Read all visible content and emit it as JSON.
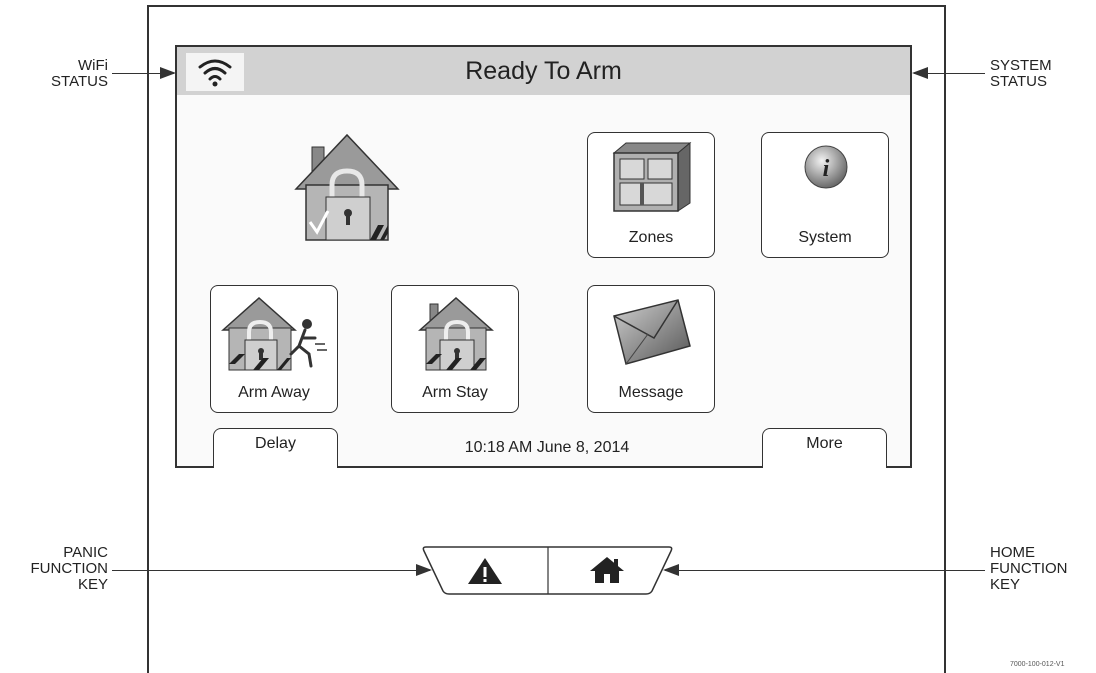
{
  "screen": {
    "system_status": "Ready To Arm",
    "datetime": "10:18 AM June 8, 2014"
  },
  "tiles": [
    {
      "label": "Zones"
    },
    {
      "label": "System"
    },
    {
      "label": "Arm Away"
    },
    {
      "label": "Arm Stay"
    },
    {
      "label": "Message"
    }
  ],
  "tabs": {
    "delay_label": "Delay",
    "more_label": "More"
  },
  "callouts": {
    "wifi": [
      "WiFi",
      "STATUS"
    ],
    "system": [
      "SYSTEM",
      "STATUS"
    ],
    "panic": [
      "PANIC",
      "FUNCTION",
      "KEY"
    ],
    "home": [
      "HOME",
      "FUNCTION",
      "KEY"
    ]
  },
  "figure_id": "7000-100-012-V1",
  "icons": {
    "wifi": "wifi-icon",
    "status_house": "house-lock-icon",
    "zones": "zones-icon",
    "system": "info-icon",
    "arm_away": "arm-away-icon",
    "arm_stay": "arm-stay-icon",
    "message": "envelope-icon",
    "panic": "warning-triangle-icon",
    "home": "home-icon"
  }
}
